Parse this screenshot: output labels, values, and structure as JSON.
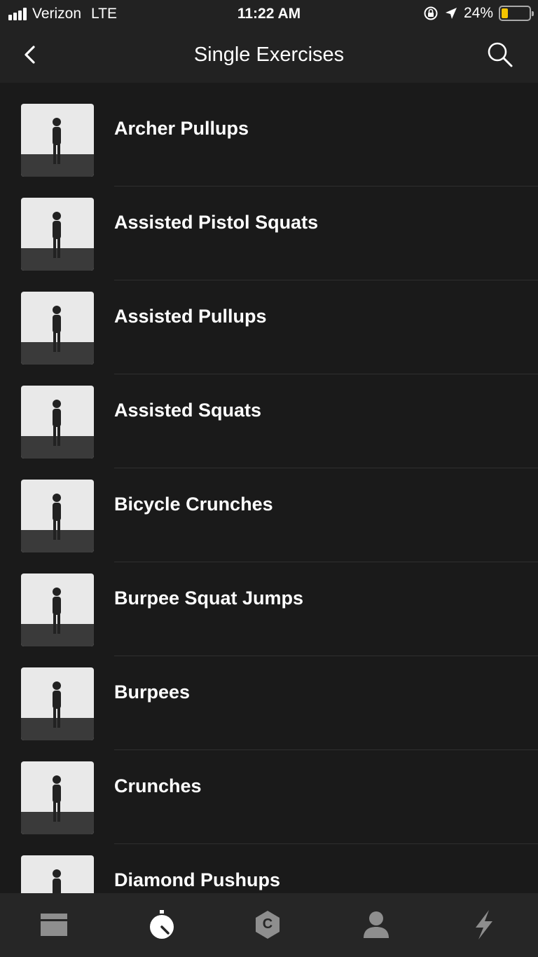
{
  "status_bar": {
    "carrier": "Verizon",
    "network": "LTE",
    "time": "11:22 AM",
    "battery": "24%",
    "battery_level": 0.24,
    "battery_color": "#f5c400"
  },
  "nav": {
    "title": "Single Exercises",
    "back_icon": "chevron-left-icon",
    "search_icon": "search-icon"
  },
  "exercises": [
    {
      "label": "Archer Pullups"
    },
    {
      "label": "Assisted Pistol Squats"
    },
    {
      "label": "Assisted Pullups"
    },
    {
      "label": "Assisted Squats"
    },
    {
      "label": "Bicycle Crunches"
    },
    {
      "label": "Burpee Squat Jumps"
    },
    {
      "label": "Burpees"
    },
    {
      "label": "Crunches"
    },
    {
      "label": "Diamond Pushups"
    }
  ],
  "tab_bar": {
    "tabs": [
      {
        "icon": "workouts-icon"
      },
      {
        "icon": "stopwatch-icon",
        "active": true
      },
      {
        "icon": "coach-icon",
        "letter": "C"
      },
      {
        "icon": "profile-icon"
      },
      {
        "icon": "lightning-icon"
      }
    ]
  },
  "colors": {
    "background": "#1a1a1a",
    "bar": "#222222",
    "text": "#ffffff",
    "tab_icon": "#8e8e8e",
    "tab_active": "#ffffff"
  }
}
